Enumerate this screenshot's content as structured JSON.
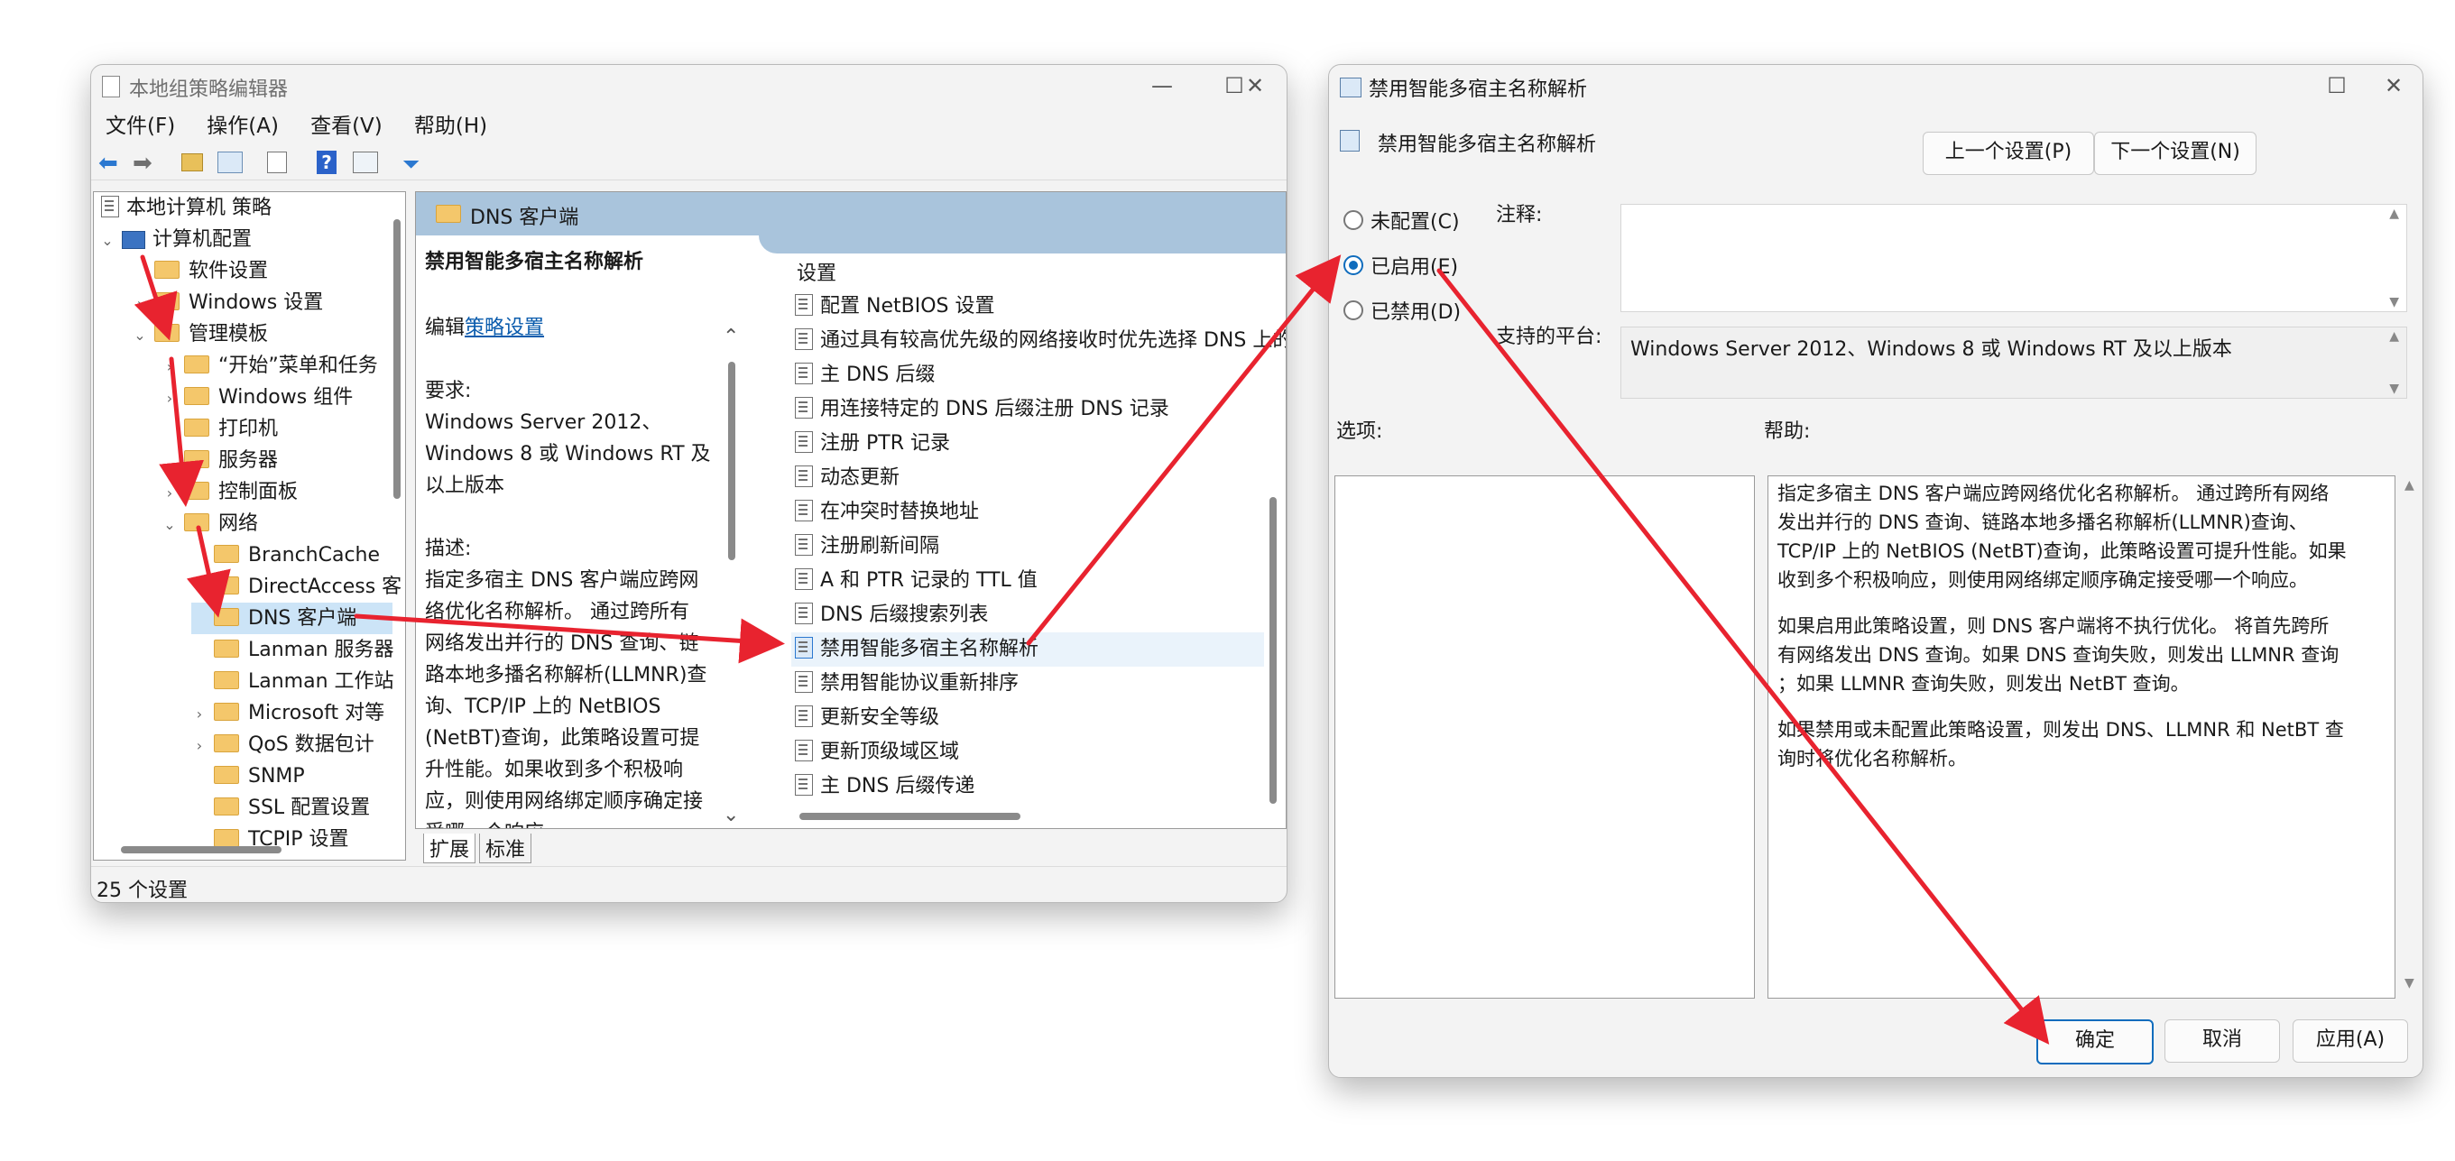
{
  "gpedit": {
    "title": "本地组策略编辑器",
    "menu": [
      "文件(F)",
      "操作(A)",
      "查看(V)",
      "帮助(H)"
    ],
    "tree": {
      "root": "本地计算机 策略",
      "computer_config": "计算机配置",
      "software_settings": "软件设置",
      "windows_settings": "Windows 设置",
      "admin_templates": "管理模板",
      "start_menu": "“开始”菜单和任务",
      "windows_components": "Windows 组件",
      "printers": "打印机",
      "server": "服务器",
      "control_panel": "控制面板",
      "network": "网络",
      "branchcache": "BranchCache",
      "directaccess": "DirectAccess 客",
      "dns_client": "DNS 客户端",
      "lanman_server": "Lanman 服务器",
      "lanman_workstation": "Lanman 工作站",
      "microsoft": "Microsoft 对等",
      "qos": "QoS 数据包计",
      "snmp": "SNMP",
      "ssl": "SSL 配置设置",
      "tcpip": "TCPIP 设置"
    },
    "header_folder": "DNS 客户端",
    "desc": {
      "title": "禁用智能多宿主名称解析",
      "edit_prefix": "编辑",
      "edit_link": "策略设置",
      "req_label": "要求:",
      "req_lines": [
        "Windows Server 2012、",
        "Windows 8 或 Windows RT 及",
        "以上版本"
      ],
      "desc_label": "描述:",
      "desc_lines": [
        "指定多宿主 DNS 客户端应跨网",
        "络优化名称解析。 通过跨所有",
        "网络发出并行的 DNS 查询、链",
        "路本地多播名称解析(LLMNR)查",
        "询、TCP/IP 上的 NetBIOS",
        "(NetBT)查询，此策略设置可提",
        "升性能。如果收到多个积极响",
        "应，则使用网络绑定顺序确定接",
        "受哪一个响应。"
      ]
    },
    "list_header": "设置",
    "settings": [
      "配置 NetBIOS 设置",
      "通过具有较高优先级的网络接收时优先选择 DNS 上的",
      "主 DNS 后缀",
      "用连接特定的 DNS 后缀注册 DNS 记录",
      "注册 PTR 记录",
      "动态更新",
      "在冲突时替换地址",
      "注册刷新间隔",
      "A 和 PTR 记录的 TTL 值",
      "DNS 后缀搜索列表",
      "禁用智能多宿主名称解析",
      "禁用智能协议重新排序",
      "更新安全等级",
      "更新顶级域区域",
      "主 DNS 后缀传递"
    ],
    "tabs": [
      "扩展",
      "标准"
    ],
    "status": "25 个设置"
  },
  "dialog": {
    "title": "禁用智能多宿主名称解析",
    "heading": "禁用智能多宿主名称解析",
    "prev_button": "上一个设置(P)",
    "next_button": "下一个设置(N)",
    "radio_not_configured": "未配置(C)",
    "radio_enabled": "已启用(E)",
    "radio_disabled": "已禁用(D)",
    "comment_label": "注释:",
    "platform_label": "支持的平台:",
    "platform_value": "Windows Server 2012、Windows 8 或 Windows RT 及以上版本",
    "options_label": "选项:",
    "help_label": "帮助:",
    "help_lines": [
      "指定多宿主 DNS 客户端应跨网络优化名称解析。 通过跨所有网络",
      "发出并行的 DNS 查询、链路本地多播名称解析(LLMNR)查询、",
      "TCP/IP 上的 NetBIOS (NetBT)查询，此策略设置可提升性能。如果",
      "收到多个积极响应，则使用网络绑定顺序确定接受哪一个响应。",
      "",
      "如果启用此策略设置，则 DNS 客户端将不执行优化。 将首先跨所",
      "有网络发出 DNS 查询。如果 DNS 查询失败，则发出 LLMNR 查询",
      "；如果 LLMNR 查询失败，则发出 NetBT 查询。",
      "",
      "如果禁用或未配置此策略设置，则发出 DNS、LLMNR 和 NetBT 查",
      "询时将优化名称解析。"
    ],
    "ok_button": "确定",
    "cancel_button": "取消",
    "apply_button": "应用(A)"
  },
  "colors": {
    "accent": "#0f6cbd",
    "arrow": "#e8232f",
    "header_band": "#a9c4dc",
    "selected": "#cce4f7"
  }
}
